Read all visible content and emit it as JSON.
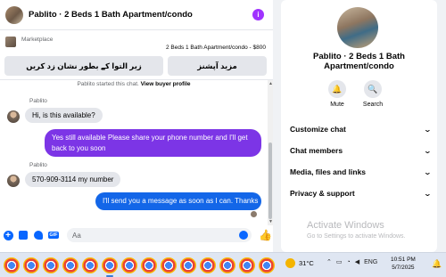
{
  "header": {
    "title": "Pablito · 2 Beds 1 Bath Apartment/condo",
    "info_icon": "i"
  },
  "marketplace": {
    "label": "Marketplace",
    "listing": "2 Beds 1 Bath Apartment/condo - $800",
    "button_mark_sold": "زیر التوا کے بطور نشان زد کریں",
    "button_more": "مزید آپشنز"
  },
  "conversation": {
    "started_text": "Pablito started this chat.",
    "view_profile": "View buyer profile",
    "messages": [
      {
        "sender": "Pablito",
        "text": "Hi, is this available?",
        "direction": "in"
      },
      {
        "text": "Yes still available Please share your phone number and I'll get back to you soon",
        "direction": "out"
      },
      {
        "sender": "Pablito",
        "text": "570-909-3114 my number",
        "direction": "in"
      },
      {
        "text": "I'll send you a message as soon as I can. Thanks",
        "direction": "out"
      }
    ]
  },
  "composer": {
    "placeholder": "Aa"
  },
  "profile_panel": {
    "title_line1": "Pablito · 2 Beds 1 Bath",
    "title_line2": "Apartment/condo",
    "actions": [
      {
        "label": "Mute",
        "icon": "bell-icon"
      },
      {
        "label": "Search",
        "icon": "search-icon"
      }
    ],
    "sections": [
      "Customize chat",
      "Chat members",
      "Media, files and links",
      "Privacy & support"
    ]
  },
  "watermark": {
    "line1": "Activate Windows",
    "line2": "Go to Settings to activate Windows."
  },
  "taskbar": {
    "weather": "31°C",
    "language": "ENG",
    "time": "10:51 PM",
    "date": "5/7/2025"
  },
  "colors": {
    "purple_bubble": "#7c35e6",
    "blue_bubble": "#1366e8",
    "accent": "#0866ff"
  }
}
